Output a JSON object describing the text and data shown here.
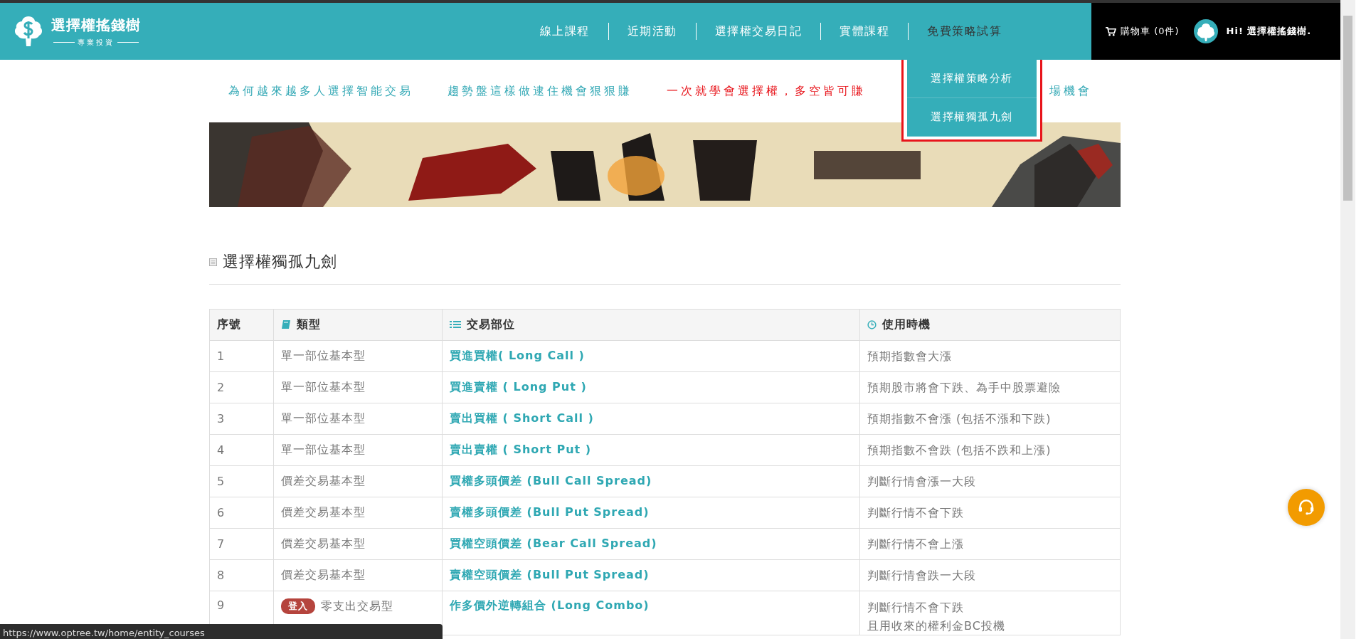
{
  "header": {
    "logo": {
      "name": "選擇權搖錢樹",
      "tagline": "專業投資"
    },
    "nav": [
      {
        "label": "線上課程",
        "selected": false
      },
      {
        "label": "近期活動",
        "selected": false
      },
      {
        "label": "選擇權交易日記",
        "selected": false
      },
      {
        "label": "實體課程",
        "selected": false
      },
      {
        "label": "免費策略試算",
        "selected": true,
        "expanded": true,
        "menu": [
          "選擇權策略分析",
          "選擇權獨孤九劍"
        ]
      }
    ],
    "cart": "購物車 (0件)",
    "greeting": "Hi! 選擇權搖錢樹."
  },
  "promos": [
    {
      "text": "為何越來越多人選擇智能交易",
      "color": "#35a9b6"
    },
    {
      "text": "趨勢盤這樣做逮住機會狠狠賺",
      "color": "#35a9b6"
    },
    {
      "text": "一次就學會選擇權，多空皆可賺",
      "color": "#e8141b"
    },
    {
      "text": "場機會",
      "color": "#35a9b6"
    }
  ],
  "section_title": "選擇權獨孤九劍",
  "table": {
    "columns": [
      "序號",
      "類型",
      "交易部位",
      "使用時機"
    ],
    "rows": [
      {
        "no": "1",
        "type": "單一部位基本型",
        "position": "買進買權( Long Call )",
        "timing": [
          "預期指數會大漲"
        ]
      },
      {
        "no": "2",
        "type": "單一部位基本型",
        "position": "買進賣權 ( Long Put )",
        "timing": [
          "預期股市將會下跌、為手中股票避險"
        ]
      },
      {
        "no": "3",
        "type": "單一部位基本型",
        "position": "賣出買權 ( Short Call )",
        "timing": [
          "預期指數不會漲 (包括不漲和下跌)"
        ]
      },
      {
        "no": "4",
        "type": "單一部位基本型",
        "position": "賣出賣權 ( Short Put )",
        "timing": [
          "預期指數不會跌 (包括不跌和上漲)"
        ]
      },
      {
        "no": "5",
        "type": "價差交易基本型",
        "position": "買權多頭價差 (Bull Call Spread)",
        "timing": [
          "判斷行情會漲一大段"
        ]
      },
      {
        "no": "6",
        "type": "價差交易基本型",
        "position": "賣權多頭價差 (Bull Put Spread)",
        "timing": [
          "判斷行情不會下跌"
        ]
      },
      {
        "no": "7",
        "type": "價差交易基本型",
        "position": "買權空頭價差 (Bear Call Spread)",
        "timing": [
          "判斷行情不會上漲"
        ]
      },
      {
        "no": "8",
        "type": "價差交易基本型",
        "position": "賣權空頭價差 (Bull Put Spread)",
        "timing": [
          "判斷行情會跌一大段"
        ]
      },
      {
        "no": "9",
        "badge": "登入",
        "type": "零支出交易型",
        "position": "作多價外逆轉組合 (Long Combo)",
        "timing": [
          "判斷行情不會下跌",
          "且用收來的權利金BC投機"
        ]
      }
    ]
  },
  "status_url": "https://www.optree.tw/home/entity_courses"
}
